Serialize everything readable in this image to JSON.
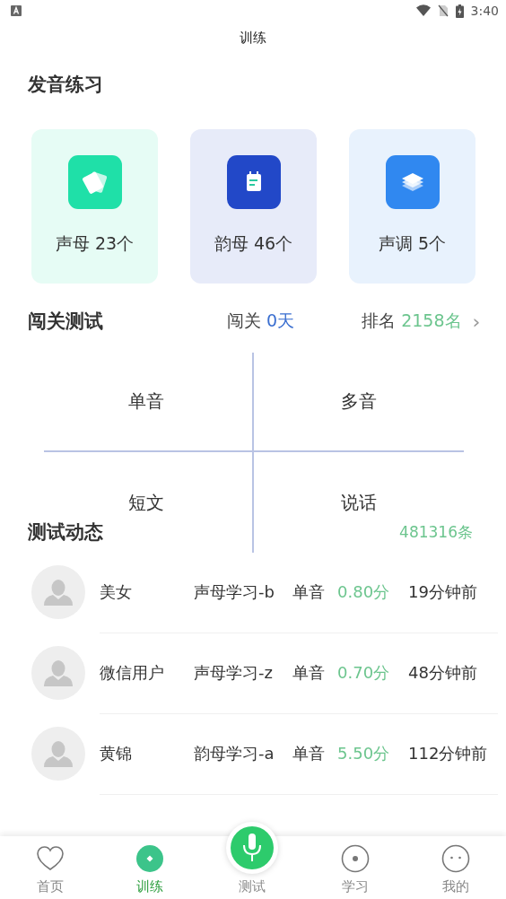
{
  "status_bar": {
    "time": "3:40"
  },
  "title": "训练",
  "practice": {
    "title": "发音练习",
    "cards": [
      {
        "label": "声母 23个",
        "kind": "cards",
        "color": "#1fe0a8"
      },
      {
        "label": "韵母 46个",
        "kind": "note",
        "color": "#2248c8"
      },
      {
        "label": "声调 5个",
        "kind": "layers",
        "color": "#3088f0"
      }
    ]
  },
  "challenge": {
    "title": "闯关测试",
    "days_label": "闯关",
    "days": "0天",
    "rank_label": "排名",
    "rank": "2158名",
    "chevron": "›",
    "modes": [
      "单音",
      "多音",
      "短文",
      "说话"
    ]
  },
  "activity": {
    "title": "测试动态",
    "count": "481316条",
    "rows": [
      {
        "name": "美女",
        "lesson": "声母学习-b",
        "type": "单音",
        "score": "0.80分",
        "time": "19分钟前"
      },
      {
        "name": "微信用户",
        "lesson": "声母学习-z",
        "type": "单音",
        "score": "0.70分",
        "time": "48分钟前"
      },
      {
        "name": "黄锦",
        "lesson": "韵母学习-a",
        "type": "单音",
        "score": "5.50分",
        "time": "112分钟前"
      }
    ]
  },
  "tabs": [
    {
      "label": "首页",
      "kind": "heart",
      "selected": false
    },
    {
      "label": "训练",
      "kind": "diamond",
      "selected": true
    },
    {
      "label": "测试",
      "kind": "mic",
      "selected": false
    },
    {
      "label": "学习",
      "kind": "dot",
      "selected": false
    },
    {
      "label": "我的",
      "kind": "face",
      "selected": false
    }
  ]
}
